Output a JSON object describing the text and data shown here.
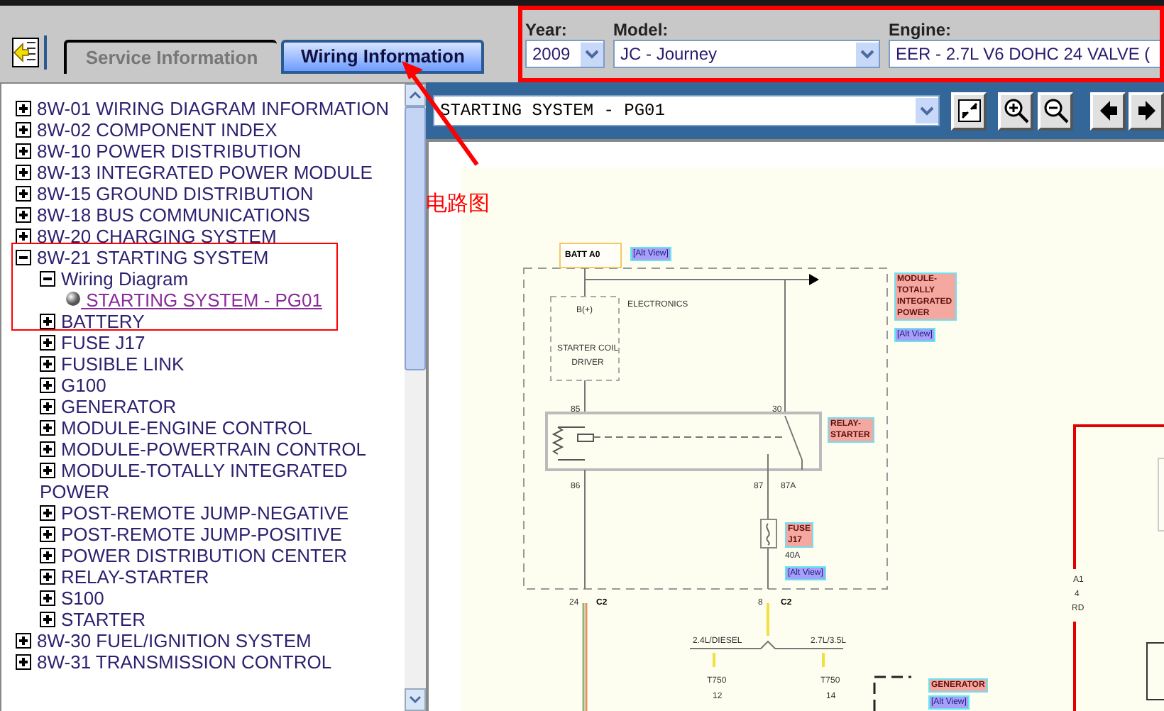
{
  "tabs": [
    {
      "label": "Service Information",
      "selected": false
    },
    {
      "label": "Wiring Information",
      "selected": true
    }
  ],
  "selectors": [
    {
      "label": "Year:",
      "value": "2009"
    },
    {
      "label": "Model:",
      "value": "JC - Journey"
    },
    {
      "label": "Engine:",
      "value": "EER - 2.7L V6 DOHC 24 VALVE ("
    }
  ],
  "tree": [
    {
      "label": "8W-01 WIRING DIAGRAM INFORMATION",
      "kind": "folder",
      "expanded": false
    },
    {
      "label": "8W-02 COMPONENT INDEX",
      "kind": "folder",
      "expanded": false
    },
    {
      "label": "8W-10 POWER DISTRIBUTION",
      "kind": "folder",
      "expanded": false
    },
    {
      "label": "8W-13 INTEGRATED POWER MODULE",
      "kind": "folder",
      "expanded": false
    },
    {
      "label": "8W-15 GROUND DISTRIBUTION",
      "kind": "folder",
      "expanded": false
    },
    {
      "label": "8W-18 BUS COMMUNICATIONS",
      "kind": "folder",
      "expanded": false
    },
    {
      "label": "8W-20 CHARGING SYSTEM",
      "kind": "folder",
      "expanded": false
    },
    {
      "label": "8W-21 STARTING SYSTEM",
      "kind": "folder",
      "expanded": true,
      "children": [
        {
          "label": "Wiring Diagram",
          "kind": "folder",
          "expanded": true,
          "children": [
            {
              "label": " STARTING SYSTEM - PG01",
              "kind": "link"
            }
          ]
        },
        {
          "label": "BATTERY",
          "kind": "folder",
          "expanded": false
        },
        {
          "label": "FUSE J17",
          "kind": "folder",
          "expanded": false
        },
        {
          "label": "FUSIBLE LINK",
          "kind": "folder",
          "expanded": false
        },
        {
          "label": "G100",
          "kind": "folder",
          "expanded": false
        },
        {
          "label": "GENERATOR",
          "kind": "folder",
          "expanded": false
        },
        {
          "label": "MODULE-ENGINE CONTROL",
          "kind": "folder",
          "expanded": false
        },
        {
          "label": "MODULE-POWERTRAIN CONTROL",
          "kind": "folder",
          "expanded": false
        },
        {
          "label": "MODULE-TOTALLY INTEGRATED POWER",
          "kind": "folder",
          "expanded": false
        },
        {
          "label": "POST-REMOTE JUMP-NEGATIVE",
          "kind": "folder",
          "expanded": false
        },
        {
          "label": "POST-REMOTE JUMP-POSITIVE",
          "kind": "folder",
          "expanded": false
        },
        {
          "label": "POWER DISTRIBUTION CENTER",
          "kind": "folder",
          "expanded": false
        },
        {
          "label": "RELAY-STARTER",
          "kind": "folder",
          "expanded": false
        },
        {
          "label": "S100",
          "kind": "folder",
          "expanded": false
        },
        {
          "label": "STARTER",
          "kind": "folder",
          "expanded": false
        }
      ]
    },
    {
      "label": "8W-30 FUEL/IGNITION SYSTEM",
      "kind": "folder",
      "expanded": false
    },
    {
      "label": "8W-31 TRANSMISSION CONTROL",
      "kind": "folder",
      "expanded": false
    }
  ],
  "page_select": {
    "value": "STARTING SYSTEM - PG01"
  },
  "annotation": {
    "label": "电路图"
  },
  "diagram": {
    "labels": [
      {
        "text": "BATT A0",
        "kind": "title"
      },
      {
        "text": "[Alt View]",
        "kind": "alt"
      },
      {
        "text": "ELECTRONICS",
        "kind": "plain"
      },
      {
        "text": "B(+)",
        "kind": "plain"
      },
      {
        "text": "STARTER COIL DRIVER",
        "kind": "plain"
      },
      {
        "text": "MODULE-TOTALLY INTEGRATED POWER",
        "kind": "tag"
      },
      {
        "text": "[Alt View]",
        "kind": "alt"
      },
      {
        "text": "85",
        "kind": "plain"
      },
      {
        "text": "30",
        "kind": "plain"
      },
      {
        "text": "RELAY-STARTER",
        "kind": "tag"
      },
      {
        "text": "86",
        "kind": "plain"
      },
      {
        "text": "87",
        "kind": "plain"
      },
      {
        "text": "87A",
        "kind": "plain"
      },
      {
        "text": "FUSE J17",
        "kind": "tag"
      },
      {
        "text": "40A",
        "kind": "plain"
      },
      {
        "text": "[Alt View]",
        "kind": "alt"
      },
      {
        "text": "24",
        "kind": "plain"
      },
      {
        "text": "C2",
        "kind": "pin"
      },
      {
        "text": "8",
        "kind": "plain"
      },
      {
        "text": "C2",
        "kind": "pin"
      },
      {
        "text": "2.4L/DIESEL",
        "kind": "plain"
      },
      {
        "text": "2.7L/3.5L",
        "kind": "plain"
      },
      {
        "text": "T750",
        "kind": "plain"
      },
      {
        "text": "12",
        "kind": "plain"
      },
      {
        "text": "T750",
        "kind": "plain"
      },
      {
        "text": "14",
        "kind": "plain"
      },
      {
        "text": "GENERATOR",
        "kind": "tag"
      },
      {
        "text": "[Alt View]",
        "kind": "alt"
      },
      {
        "text": "A1",
        "kind": "plain"
      },
      {
        "text": "4",
        "kind": "plain"
      },
      {
        "text": "RD",
        "kind": "plain"
      }
    ]
  }
}
